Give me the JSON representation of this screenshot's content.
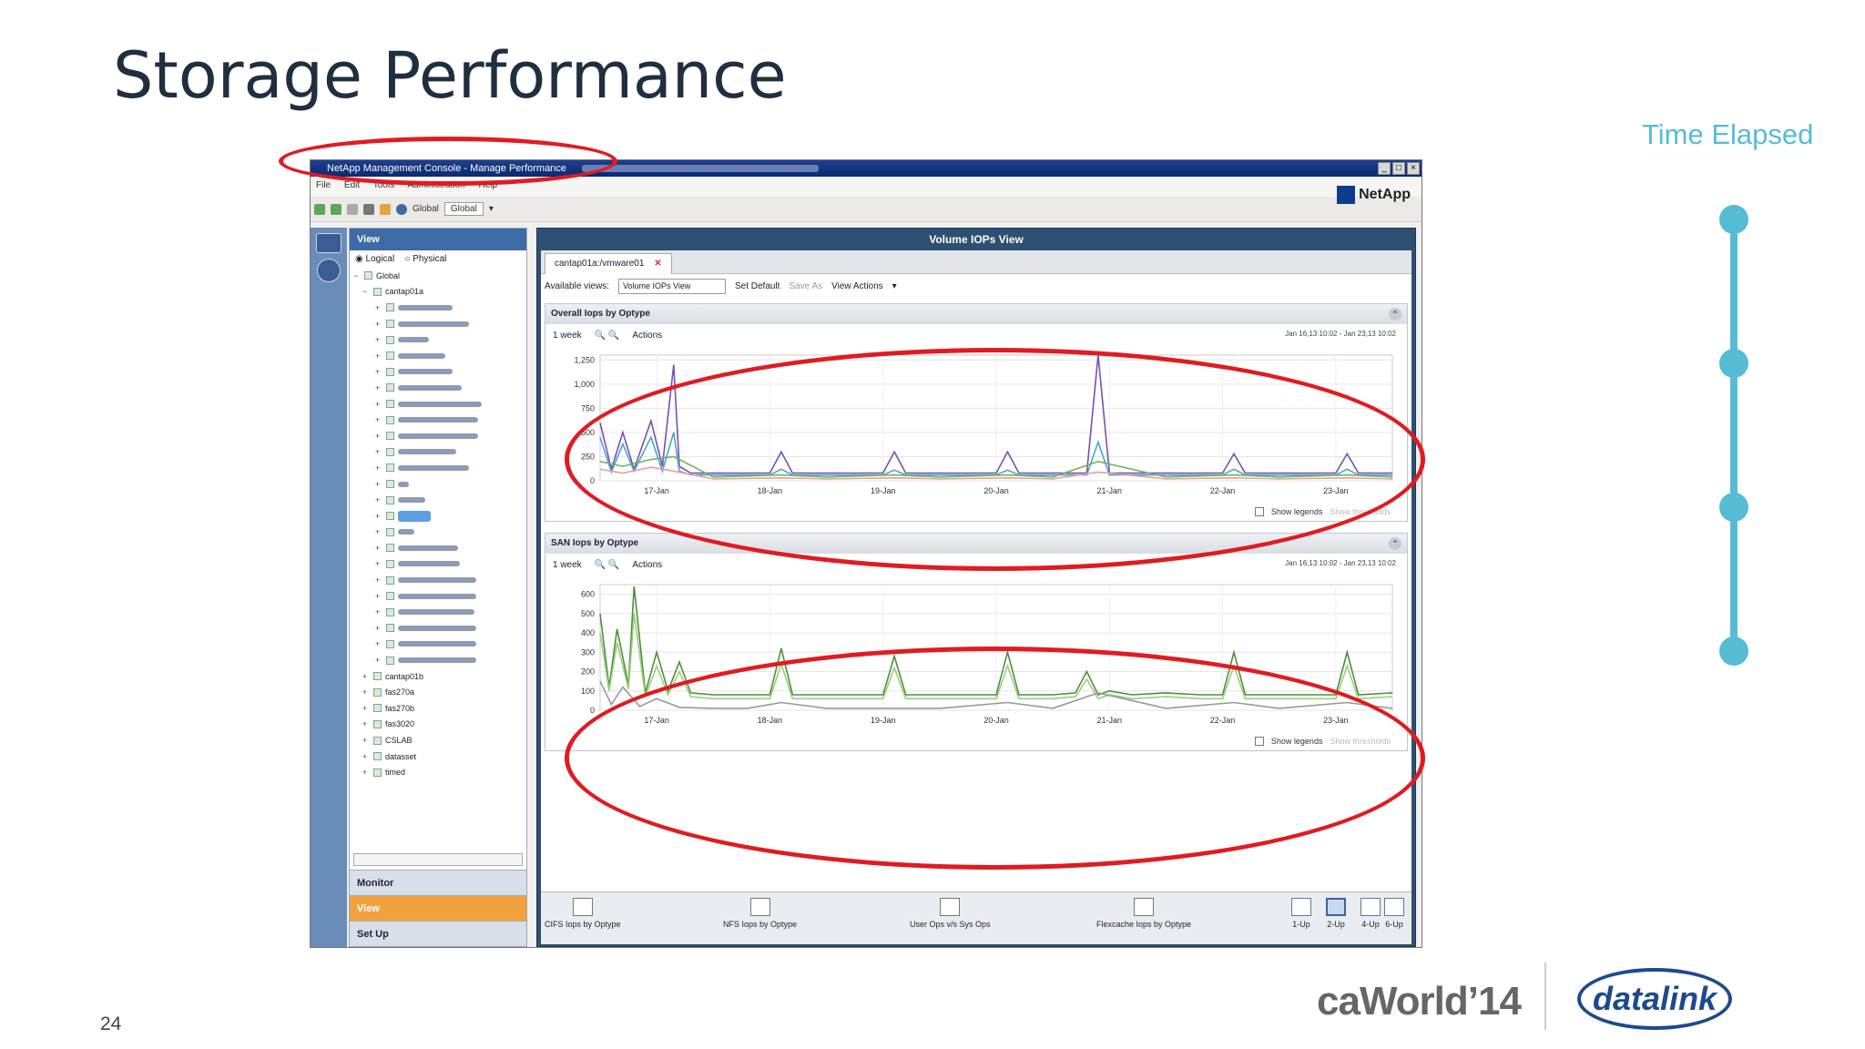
{
  "slide": {
    "title": "Storage Performance",
    "time_elapsed_label": "Time Elapsed",
    "page_number": "24",
    "timeline_stops": 4,
    "accent_color": "#56bcd4",
    "highlight_color": "#e01b22",
    "logo_ca_world": "caWorld’14",
    "logo_datalink": "datalink"
  },
  "window": {
    "title": "NetApp Management Console - Manage Performance",
    "menu": [
      "File",
      "Edit",
      "Tools",
      "Administration",
      "Help"
    ],
    "toolbar": {
      "global_label": "Global",
      "global_dropdown": "Global"
    },
    "brand": "NetApp"
  },
  "nav": {
    "header": "View",
    "radio_logical": "Logical",
    "radio_physical": "Physical",
    "root": "Global",
    "cluster": "cantap01a",
    "cluster2": "cantap01b",
    "bottom_items": [
      "fas270a",
      "fas270b",
      "fas3020",
      "CSLAB",
      "datasset",
      "timed"
    ],
    "tabs": {
      "monitor": "Monitor",
      "view": "View",
      "setup": "Set Up"
    }
  },
  "main": {
    "header": "Volume IOPs View",
    "tab_label": "cantap01a:/vmware01",
    "available_views_label": "Available views:",
    "available_views_value": "Volume IOPs View",
    "set_default": "Set Default",
    "save_as": "Save As",
    "view_actions": "View Actions",
    "panels": [
      {
        "title": "Overall Iops by Optype",
        "range": "1 week",
        "actions": "Actions",
        "date_range": "Jan 16,13 10:02 - Jan 23,13 10:02",
        "show_legends": "Show legends",
        "show_thresholds": "Show thresholds"
      },
      {
        "title": "SAN Iops by Optype",
        "range": "1 week",
        "actions": "Actions",
        "date_range": "Jan 16,13 10:02 - Jan 23,13 10:02",
        "show_legends": "Show legends",
        "show_thresholds": "Show thresholds"
      }
    ],
    "bottom_actions": [
      "CIFS Iops by Optype",
      "NFS Iops by Optype",
      "User Ops v/s Sys Ops",
      "Flexcache Iops by Optype"
    ],
    "layouts": [
      "1-Up",
      "2-Up",
      "4-Up",
      "6-Up"
    ]
  },
  "chart_data": [
    {
      "type": "line",
      "title": "Overall Iops by Optype",
      "ylabel": "",
      "ylim": [
        0,
        1300
      ],
      "yticks": [
        0,
        250,
        500,
        750,
        1000,
        1250
      ],
      "ytick_labels": [
        "0",
        "250",
        "500",
        "750",
        "1,000",
        "1,250"
      ],
      "xtick_labels": [
        "17-Jan",
        "18-Jan",
        "19-Jan",
        "20-Jan",
        "21-Jan",
        "22-Jan",
        "23-Jan"
      ],
      "xlim": [
        0,
        7
      ],
      "series": [
        {
          "color": "#7a4fb5",
          "x": [
            0,
            0.1,
            0.2,
            0.3,
            0.45,
            0.55,
            0.65,
            0.7,
            0.8,
            1.0,
            1.5,
            1.6,
            1.7,
            2.0,
            2.5,
            2.6,
            2.7,
            3.0,
            3.5,
            3.6,
            3.7,
            4.0,
            4.3,
            4.4,
            4.5,
            4.6,
            4.7,
            5.0,
            5.5,
            5.6,
            5.7,
            6.0,
            6.5,
            6.6,
            6.7,
            7.0
          ],
          "y": [
            600,
            120,
            500,
            120,
            620,
            150,
            1200,
            150,
            80,
            80,
            80,
            300,
            80,
            80,
            80,
            300,
            80,
            80,
            80,
            300,
            80,
            80,
            80,
            1300,
            80,
            80,
            80,
            80,
            80,
            280,
            80,
            80,
            80,
            280,
            80,
            80
          ]
        },
        {
          "color": "#4aa6c8",
          "x": [
            0,
            0.1,
            0.2,
            0.3,
            0.45,
            0.55,
            0.65,
            0.7,
            0.8,
            1.0,
            1.5,
            1.6,
            1.7,
            2.0,
            2.5,
            2.6,
            2.7,
            3.0,
            3.5,
            3.6,
            3.7,
            4.0,
            4.3,
            4.4,
            4.5,
            4.6,
            4.7,
            5.0,
            5.5,
            5.6,
            5.7,
            6.0,
            6.5,
            6.6,
            6.7,
            7.0
          ],
          "y": [
            450,
            90,
            380,
            100,
            450,
            100,
            500,
            100,
            60,
            60,
            60,
            120,
            60,
            60,
            60,
            110,
            60,
            60,
            60,
            110,
            60,
            60,
            60,
            400,
            60,
            60,
            60,
            60,
            60,
            120,
            60,
            60,
            60,
            120,
            60,
            60
          ]
        },
        {
          "color": "#6fb35c",
          "x": [
            0,
            0.2,
            0.45,
            0.65,
            1.0,
            1.6,
            2.0,
            2.6,
            3.0,
            3.6,
            4.0,
            4.4,
            5.0,
            5.6,
            6.0,
            6.6,
            7.0
          ],
          "y": [
            200,
            150,
            220,
            250,
            40,
            60,
            40,
            60,
            40,
            60,
            40,
            200,
            40,
            60,
            40,
            60,
            40
          ]
        },
        {
          "color": "#e7a09a",
          "x": [
            0,
            0.2,
            0.45,
            0.65,
            1.0,
            1.6,
            2.0,
            2.6,
            3.0,
            3.6,
            4.0,
            4.4,
            5.0,
            5.6,
            6.0,
            6.6,
            7.0
          ],
          "y": [
            120,
            80,
            140,
            100,
            20,
            30,
            20,
            30,
            20,
            30,
            20,
            90,
            20,
            30,
            20,
            30,
            20
          ]
        }
      ]
    },
    {
      "type": "line",
      "title": "SAN Iops by Optype",
      "ylabel": "",
      "ylim": [
        0,
        650
      ],
      "yticks": [
        0,
        100,
        200,
        300,
        400,
        500,
        600
      ],
      "ytick_labels": [
        "0",
        "100",
        "200",
        "300",
        "400",
        "500",
        "600"
      ],
      "xtick_labels": [
        "17-Jan",
        "18-Jan",
        "19-Jan",
        "20-Jan",
        "21-Jan",
        "22-Jan",
        "23-Jan"
      ],
      "xlim": [
        0,
        7
      ],
      "series": [
        {
          "color": "#4e8f3a",
          "x": [
            0,
            0.08,
            0.15,
            0.25,
            0.3,
            0.4,
            0.5,
            0.6,
            0.7,
            0.8,
            1.0,
            1.5,
            1.6,
            1.7,
            2.0,
            2.5,
            2.6,
            2.7,
            3.0,
            3.5,
            3.6,
            3.7,
            4.0,
            4.2,
            4.3,
            4.4,
            4.5,
            4.7,
            5.0,
            5.3,
            5.5,
            5.6,
            5.7,
            6.0,
            6.5,
            6.6,
            6.7,
            7.0
          ],
          "y": [
            500,
            120,
            420,
            130,
            640,
            90,
            300,
            100,
            250,
            90,
            80,
            80,
            320,
            80,
            80,
            80,
            280,
            80,
            80,
            80,
            300,
            80,
            80,
            90,
            200,
            80,
            100,
            80,
            90,
            80,
            80,
            300,
            80,
            80,
            80,
            300,
            80,
            90
          ]
        },
        {
          "color": "#9ccf7e",
          "x": [
            0,
            0.08,
            0.15,
            0.25,
            0.3,
            0.4,
            0.5,
            0.6,
            0.7,
            0.8,
            1.0,
            1.5,
            1.6,
            1.7,
            2.0,
            2.5,
            2.6,
            2.7,
            3.0,
            3.5,
            3.6,
            3.7,
            4.0,
            4.2,
            4.3,
            4.4,
            4.5,
            4.7,
            5.0,
            5.3,
            5.5,
            5.6,
            5.7,
            6.0,
            6.5,
            6.6,
            6.7,
            7.0
          ],
          "y": [
            400,
            100,
            350,
            110,
            500,
            70,
            230,
            80,
            200,
            70,
            60,
            60,
            240,
            60,
            60,
            60,
            220,
            60,
            60,
            60,
            230,
            60,
            60,
            70,
            160,
            60,
            80,
            60,
            70,
            60,
            60,
            230,
            60,
            60,
            60,
            230,
            60,
            70
          ]
        },
        {
          "color": "#999999",
          "x": [
            0,
            0.1,
            0.2,
            0.35,
            0.5,
            0.7,
            1.0,
            1.3,
            1.6,
            2.0,
            2.6,
            3.0,
            3.6,
            4.0,
            4.4,
            5.0,
            5.6,
            6.0,
            6.6,
            7.0
          ],
          "y": [
            150,
            30,
            120,
            20,
            60,
            15,
            10,
            10,
            40,
            10,
            10,
            10,
            40,
            10,
            90,
            10,
            40,
            10,
            40,
            10
          ]
        }
      ]
    }
  ]
}
